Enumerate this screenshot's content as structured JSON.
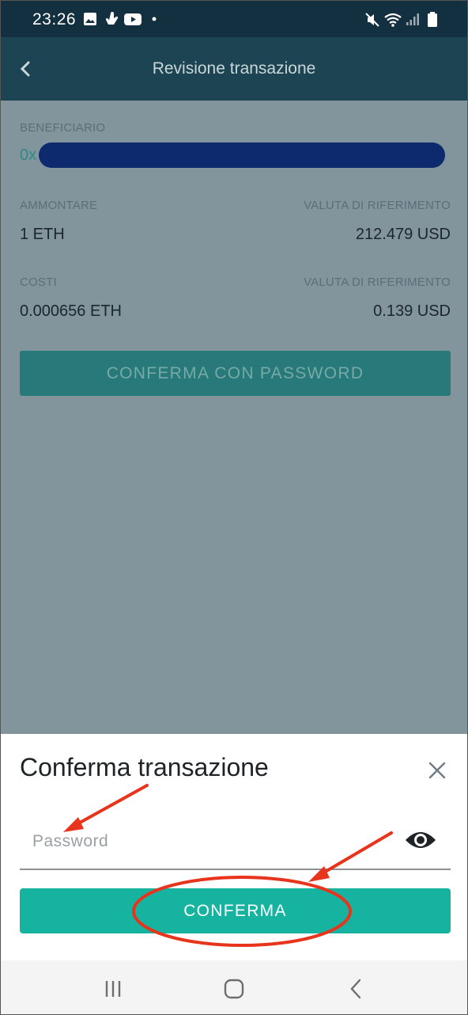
{
  "status_bar": {
    "time": "23:26",
    "left_icons": [
      "gallery-icon",
      "hand-icon",
      "youtube-icon",
      "dot-icon"
    ],
    "right_icons": [
      "mute-icon",
      "wifi-icon",
      "signal-icon",
      "battery-icon"
    ]
  },
  "header": {
    "title": "Revisione transazione",
    "back_icon": "chevron-left-icon"
  },
  "transaction": {
    "beneficiary_label": "BENEFICIARIO",
    "beneficiary_prefix": "0x",
    "amount_label": "AMMONTARE",
    "amount_value": "1 ETH",
    "amount_ref_label": "VALUTA DI RIFERIMENTO",
    "amount_ref_value": "212.479 USD",
    "costs_label": "COSTI",
    "costs_value": "0.000656 ETH",
    "costs_ref_label": "VALUTA DI RIFERIMENTO",
    "costs_ref_value": "0.139 USD",
    "confirm_with_password_label": "CONFERMA CON PASSWORD"
  },
  "sheet": {
    "title": "Conferma transazione",
    "password_placeholder": "Password",
    "password_value": "",
    "confirm_label": "CONFERMA",
    "close_icon": "close-icon",
    "eye_icon": "eye-icon"
  },
  "colors": {
    "status_bar": "#12303f",
    "header": "#1d4452",
    "overlay": "#82959d",
    "accent": "#16b3a1",
    "annotation": "#e8341c"
  },
  "nav": [
    "recent-apps-icon",
    "home-icon",
    "back-icon"
  ]
}
